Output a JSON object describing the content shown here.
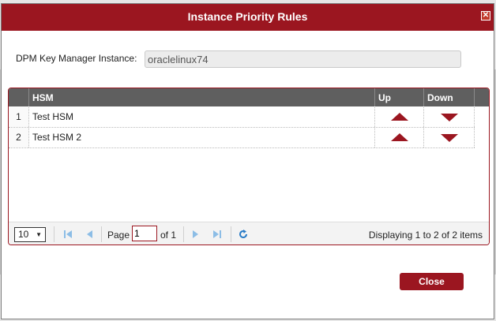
{
  "dialog": {
    "title": "Instance Priority Rules",
    "close_icon": "close-icon"
  },
  "key_manager": {
    "label": "DPM Key Manager Instance:",
    "value": "oraclelinux74"
  },
  "grid": {
    "columns": [
      "HSM",
      "Up",
      "Down"
    ],
    "rows": [
      {
        "num": "1",
        "name": "Test HSM"
      },
      {
        "num": "2",
        "name": "Test HSM 2"
      }
    ]
  },
  "pager": {
    "page_size": "10",
    "page_label": "Page",
    "page_value": "1",
    "of_label": "of 1",
    "display_text": "Displaying 1 to 2 of 2 items"
  },
  "buttons": {
    "close": "Close"
  },
  "colors": {
    "accent": "#9b1620",
    "header_bg": "#5f5f5f",
    "pager_icon": "#5aa0d8"
  }
}
